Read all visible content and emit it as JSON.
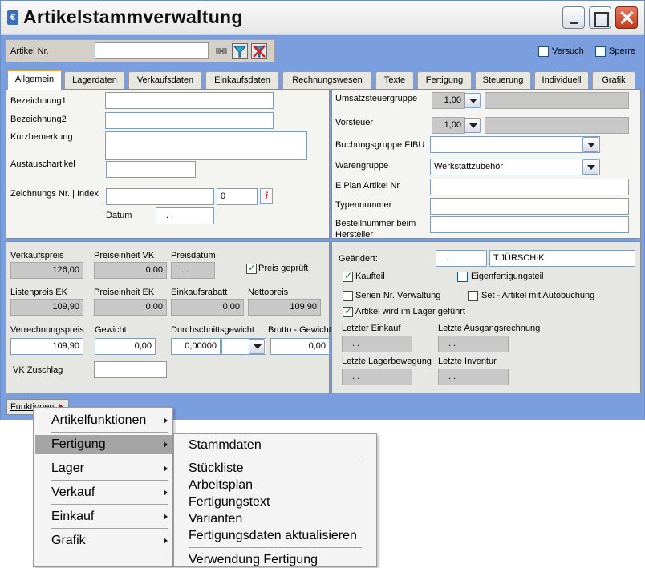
{
  "window": {
    "title": "Artikelstammverwaltung"
  },
  "toolbar": {
    "artikel_nr_label": "Artikel Nr.",
    "artikel_nr_value": "",
    "versuch_label": "Versuch",
    "versuch_checked": false,
    "sperre_label": "Sperre",
    "sperre_checked": false
  },
  "tabs": [
    {
      "label": "Allgemein",
      "active": true
    },
    {
      "label": "Lagerdaten"
    },
    {
      "label": "Verkaufsdaten"
    },
    {
      "label": "Einkaufsdaten"
    },
    {
      "label": "Rechnungswesen"
    },
    {
      "label": "Texte"
    },
    {
      "label": "Fertigung"
    },
    {
      "label": "Steuerung"
    },
    {
      "label": "Individuell"
    },
    {
      "label": "Grafik"
    }
  ],
  "left_top": {
    "bezeichnung1_label": "Bezeichnung1",
    "bezeichnung2_label": "Bezeichnung2",
    "kurzbemerkung_label": "Kurzbemerkung",
    "austauschartikel_label": "Austauschartikel",
    "zeichnungs_label": "Zeichnungs Nr. | Index",
    "index_value": "0",
    "datum_label": "Datum",
    "datum_value": ". ."
  },
  "right_top": {
    "umsatzsteuergruppe_label": "Umsatzsteuergruppe",
    "umsatzsteuergruppe_value": "1,00",
    "vorsteuer_label": "Vorsteuer",
    "vorsteuer_value": "1,00",
    "buchungsgruppe_label": "Buchungsgruppe FIBU",
    "buchungsgruppe_value": "",
    "warengruppe_label": "Warengruppe",
    "warengruppe_value": "Werkstattzubehör",
    "eplan_label": "E Plan Artikel Nr",
    "typennummer_label": "Typennummer",
    "bestellnummer_label_1": "Bestellnummer beim",
    "bestellnummer_label_2": "Hersteller"
  },
  "prices": {
    "verkaufspreis_label": "Verkaufspreis",
    "verkaufspreis_value": "126,00",
    "preiseinheit_vk_label": "Preiseinheit VK",
    "preiseinheit_vk_value": "0,00",
    "preisdatum_label": "Preisdatum",
    "preisdatum_value": ". .",
    "preis_geprueft_label": "Preis geprüft",
    "preis_geprueft_checked": true,
    "listenpreis_ek_label": "Listenpreis EK",
    "listenpreis_ek_value": "109,90",
    "preiseinheit_ek_label": "Preiseinheit EK",
    "preiseinheit_ek_value": "0,00",
    "einkaufsrabatt_label": "Einkaufsrabatt",
    "einkaufsrabatt_value": "0,00",
    "nettopreis_label": "Nettopreis",
    "nettopreis_value": "109,90",
    "verrechnungspreis_label": "Verrechnungspreis",
    "verrechnungspreis_value": "109,90",
    "gewicht_label": "Gewicht",
    "gewicht_value": "0,00",
    "durchschnittsgewicht_label": "Durchschnittsgewicht",
    "durchschnittsgewicht_value": "0,00000",
    "brutto_gewicht_label": "Brutto - Gewicht",
    "brutto_gewicht_value": "0,00",
    "vk_zuschlag_label": "VK Zuschlag"
  },
  "status": {
    "geaendert_label": "Geändert:",
    "geaendert_date": ". .",
    "geaendert_user": "T.JÜRSCHIK",
    "kaufteil_label": "Kaufteil",
    "kaufteil_checked": true,
    "eigenfertigungsteil_label": "Eigenfertigungsteil",
    "eigenfertigungsteil_checked": false,
    "serien_label": "Serien Nr. Verwaltung",
    "serien_checked": false,
    "set_label": "Set - Artikel mit Autobuchung",
    "set_checked": false,
    "lager_label": "Artikel wird im Lager geführt",
    "lager_checked": true,
    "letzter_einkauf_label": "Letzter Einkauf",
    "letzter_einkauf_value": ". .",
    "letzte_ausgangsrechnung_label": "Letzte Ausgangsrechnung",
    "letzte_ausgangsrechnung_value": ". .",
    "letzte_lagerbewegung_label": "Letzte Lagerbewegung",
    "letzte_lagerbewegung_value": ". .",
    "letzte_inventur_label": "Letzte Inventur",
    "letzte_inventur_value": ". ."
  },
  "funktionen_button": "Funktionen",
  "menu": {
    "items": [
      {
        "label": "Artikelfunktionen"
      },
      {
        "label": "Fertigung",
        "highlighted": true
      },
      {
        "label": "Lager"
      },
      {
        "label": "Verkauf"
      },
      {
        "label": "Einkauf"
      },
      {
        "label": "Grafik"
      }
    ]
  },
  "submenu": {
    "items": [
      {
        "label": "Stammdaten"
      },
      {
        "label": "Stückliste"
      },
      {
        "label": "Arbeitsplan"
      },
      {
        "label": "Fertigungstext"
      },
      {
        "label": "Varianten"
      },
      {
        "label": "Fertigungsdaten aktualisieren"
      },
      {
        "label": "Verwendung Fertigung"
      }
    ]
  }
}
